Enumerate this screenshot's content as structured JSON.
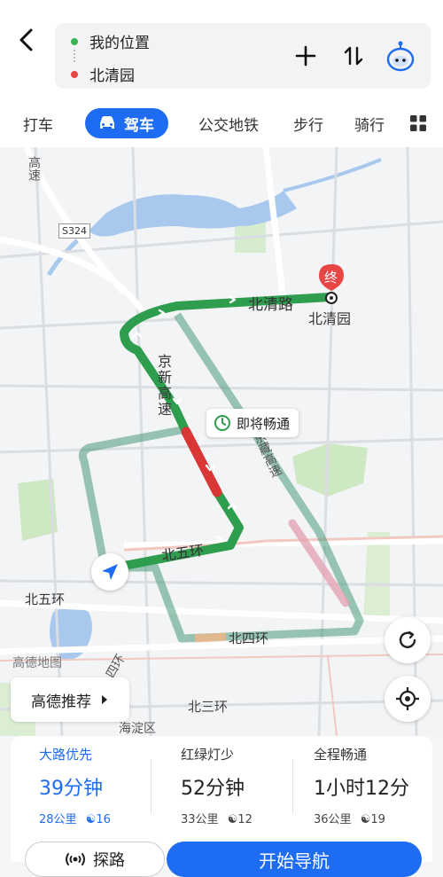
{
  "header": {
    "from_location": "我的位置",
    "to_location": "北清园"
  },
  "tabs": [
    {
      "label": "打车"
    },
    {
      "label": "驾车"
    },
    {
      "label": "公交地铁"
    },
    {
      "label": "步行"
    },
    {
      "label": "骑行"
    }
  ],
  "map": {
    "labels": {
      "gaosu": "高速",
      "s324": "S324",
      "beiqing_road": "北清路",
      "beiqingyuan": "北清园",
      "end_marker": "终",
      "jingxin": "京新高速",
      "jingzang": "京藏高速",
      "beiwuhuan_route": "北五环",
      "beiwuhuan_left": "北五环",
      "beisihuan": "北四环",
      "beisanhuan": "北三环",
      "haidian": "海淀区",
      "sihuan": "四环",
      "gaode_map": "高德地图"
    },
    "callout": "即将畅通"
  },
  "recommend_button": "高德推荐",
  "route_options": [
    {
      "title": "大路优先",
      "time": "39分钟",
      "distance": "28公里",
      "lights": "16"
    },
    {
      "title": "红绿灯少",
      "time": "52分钟",
      "distance": "33公里",
      "lights": "12"
    },
    {
      "title": "全程畅通",
      "time": "1小时12分",
      "distance": "36公里",
      "lights": "19"
    }
  ],
  "actions": {
    "explore": "探路",
    "start": "开始导航"
  },
  "colors": {
    "accent": "#1e6cf2",
    "route_green": "#34a853",
    "congestion_red": "#d93636",
    "end_marker": "#e84545"
  }
}
